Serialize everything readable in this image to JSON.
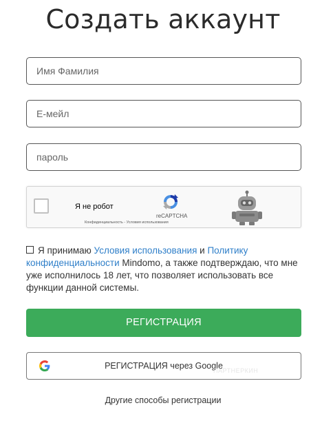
{
  "page": {
    "title": "Создать аккаунт"
  },
  "form": {
    "name_placeholder": "Имя Фамилия",
    "email_placeholder": "Е-мейл",
    "password_placeholder": "пароль"
  },
  "recaptcha": {
    "label": "Я не робот",
    "brand": "reCAPTCHA",
    "privacy": "Конфиденциальность - Условия использования",
    "checked": false
  },
  "agreement": {
    "checked": false,
    "text_1": "Я принимаю",
    "link_terms": "Условия использования",
    "text_2": "и",
    "link_privacy": "Политику конфиденциальности",
    "text_3": "Mindomo, а также подтверждаю, что мне уже исполнилось 18 лет, что позволяет использовать все функции данной системы."
  },
  "buttons": {
    "register": "РЕГИСТРАЦИЯ",
    "google": "РЕГИСТРАЦИЯ через Google",
    "other": "Другие способы регистрации"
  },
  "colors": {
    "register_bg": "#3cab5a",
    "link": "#2f7fc9",
    "title": "#2b2b2b"
  },
  "icons": {
    "google": "google-g-icon",
    "recaptcha": "recaptcha-logo-icon",
    "robot": "robot-icon"
  },
  "watermark": "ПАРТНЕРКИН"
}
